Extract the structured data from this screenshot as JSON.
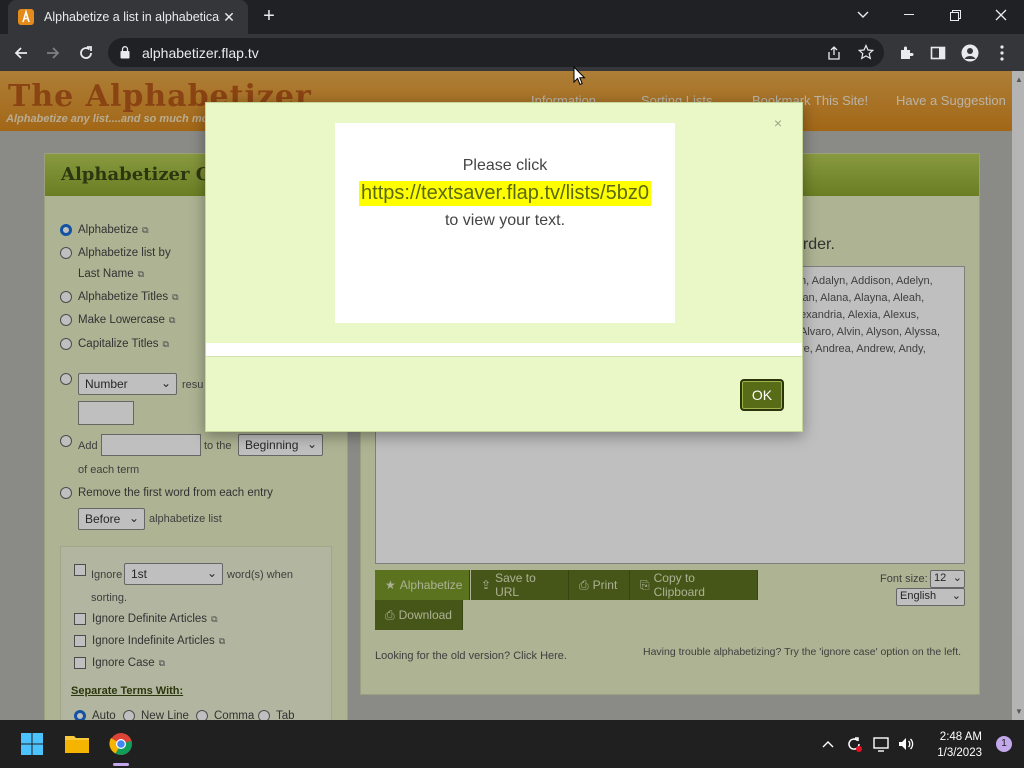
{
  "browser": {
    "tab_title": "Alphabetize a list in alphabetical",
    "url": "alphabetizer.flap.tv"
  },
  "site": {
    "logo": "The Alphabetizer",
    "logo_sub": "Alphabetize any list....and so much more",
    "nav": [
      "Information",
      "Sorting Lists",
      "Bookmark This Site!",
      "Have a Suggestion"
    ],
    "options_title": "Alphabetizer Op",
    "options": [
      "Alphabetize",
      "Alphabetize list by",
      "Last Name",
      "Alphabetize Titles",
      "Make Lowercase",
      "Capitalize Titles"
    ],
    "number_select": "Number",
    "results_partial": "resu",
    "add_label": "Add",
    "to_the_label": "to the",
    "position_select": "Beginning",
    "each_term_label": "of each term",
    "remove_first_label": "Remove the first word from each entry",
    "before_select": "Before",
    "alphabetize_list_label": "alphabetize list",
    "ignore_label": "Ignore",
    "ignore_select": "1st",
    "words_when_label": "word(s) when",
    "sorting_label": "sorting.",
    "ignore_definite": "Ignore Definite Articles",
    "ignore_indefinite": "Ignore Indefinite Articles",
    "ignore_case": "Ignore Case",
    "separate_terms": "Separate Terms With:",
    "sep_auto": "Auto",
    "sep_newline": "New Line",
    "sep_comma": "Comma",
    "sep_tab": "Tab",
    "order_text": "order.",
    "textarea_lines": [
      "h, Adalyn, Addison, Adelyn,",
      "lan, Alana, Alayna, Aleah,",
      "exandria, Alexia, Alexus,",
      "Alvaro, Alvin, Alyson, Alyssa,",
      "re, Andrea, Andrew, Andy,"
    ],
    "btn_alphabetize": "Alphabetize",
    "btn_save_url": "Save to URL",
    "btn_print": "Print",
    "btn_copy": "Copy to Clipboard",
    "btn_download": "Download",
    "font_size_label": "Font size:",
    "font_size_value": "12",
    "language_value": "English",
    "old_version": "Looking for the old version? Click Here.",
    "trouble_text": "Having trouble alphabetizing? Try the 'ignore case' option on the left."
  },
  "modal": {
    "line1": "Please click",
    "link": "https://textsaver.flap.tv/lists/5bz0",
    "line3": "to view your text.",
    "close": "×",
    "ok": "OK"
  },
  "taskbar": {
    "time": "2:48 AM",
    "date": "1/3/2023",
    "notifications": "1"
  }
}
